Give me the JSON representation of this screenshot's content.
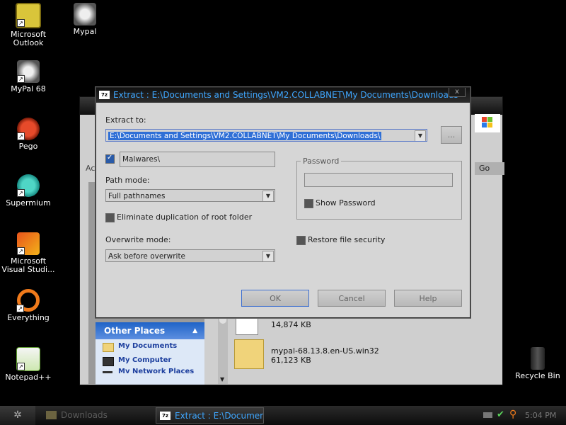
{
  "desktop": {
    "icons": [
      {
        "label": "Microsoft Outlook",
        "icon": "outlook-icon"
      },
      {
        "label": "Mypal",
        "icon": "mypal-icon"
      },
      {
        "label": "MyPal 68",
        "icon": "mypal68-icon"
      },
      {
        "label": "Pego",
        "icon": "pego-icon"
      },
      {
        "label": "Supermium",
        "icon": "supermium-icon"
      },
      {
        "label": "Microsoft Visual Studi...",
        "icon": "visual-studio-icon"
      },
      {
        "label": "Everything",
        "icon": "everything-icon"
      },
      {
        "label": "Notepad++",
        "icon": "notepadpp-icon"
      },
      {
        "label": "Recycle Bin",
        "icon": "recycle-bin-icon"
      }
    ]
  },
  "explorer": {
    "address_prefix": "Ac",
    "go_label": "Go",
    "other_places": {
      "title": "Other Places",
      "items": [
        "My Documents",
        "My Computer",
        "My Network Places"
      ]
    },
    "files": [
      {
        "size": "14,874 KB"
      },
      {
        "name": "mypal-68.13.8.en-US.win32",
        "size": "61,123 KB"
      }
    ]
  },
  "dialog": {
    "title": "Extract : E:\\Documents and Settings\\VM2.COLLABNET\\My Documents\\Downloads",
    "close_label": "x",
    "extract_to_label": "Extract to:",
    "extract_to_value": "E:\\Documents and Settings\\VM2.COLLABNET\\My Documents\\Downloads\\",
    "browse_label": "...",
    "subfolder_value": "Malwares\\",
    "path_mode_label": "Path mode:",
    "path_mode_value": "Full pathnames",
    "eliminate_label": "Eliminate duplication of root folder",
    "overwrite_label": "Overwrite mode:",
    "overwrite_value": "Ask before overwrite",
    "password_group": "Password",
    "show_password_label": "Show Password",
    "restore_security_label": "Restore file security",
    "ok_label": "OK",
    "cancel_label": "Cancel",
    "help_label": "Help"
  },
  "taskbar": {
    "tasks": [
      {
        "label": "Downloads",
        "color": "#5a5a5a"
      },
      {
        "label": "Extract : E:\\Documen...",
        "color": "#3fa7ff"
      }
    ],
    "clock": "5:04 PM"
  },
  "colors": {
    "accent": "#3fa7ff",
    "panel_header": "#1f63c7"
  }
}
